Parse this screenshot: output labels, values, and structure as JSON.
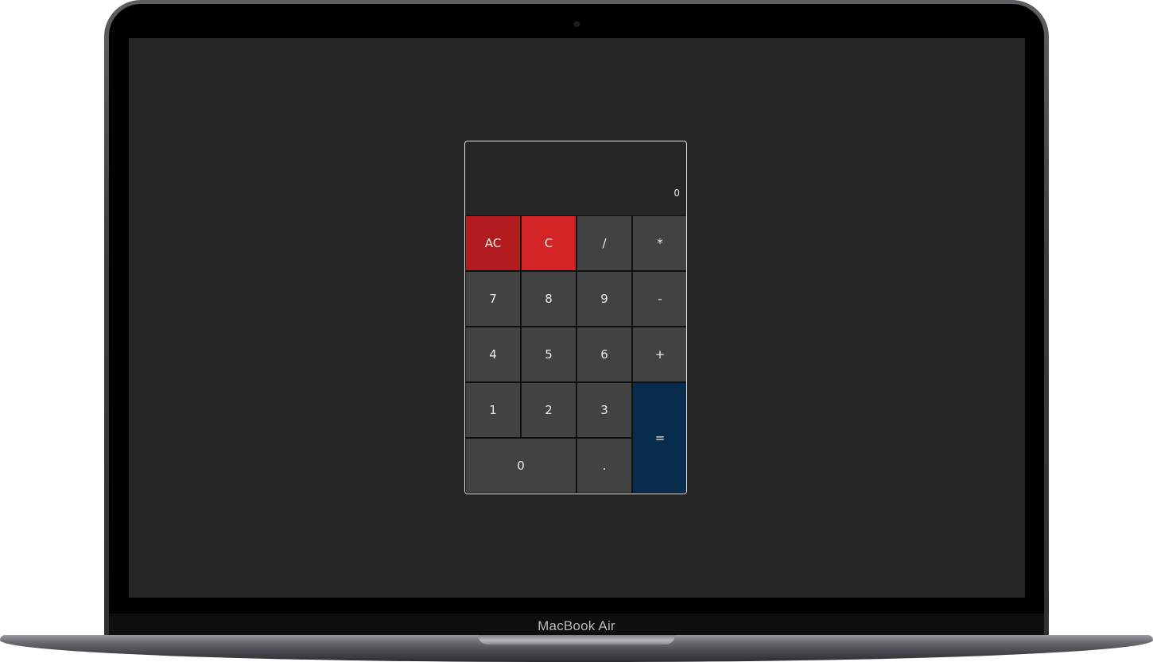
{
  "device": {
    "label": "MacBook Air"
  },
  "calculator": {
    "display": "0",
    "keys": {
      "all_clear": "AC",
      "clear": "C",
      "divide": "/",
      "multiply": "*",
      "seven": "7",
      "eight": "8",
      "nine": "9",
      "subtract": "-",
      "four": "4",
      "five": "5",
      "six": "6",
      "add": "+",
      "one": "1",
      "two": "2",
      "three": "3",
      "equals": "=",
      "zero": "0",
      "decimal": "."
    },
    "colors": {
      "screen_background": "#252525",
      "key": "#424242",
      "all_clear": "#b31c1e",
      "clear": "#d42526",
      "equals": "#082c4b"
    }
  }
}
